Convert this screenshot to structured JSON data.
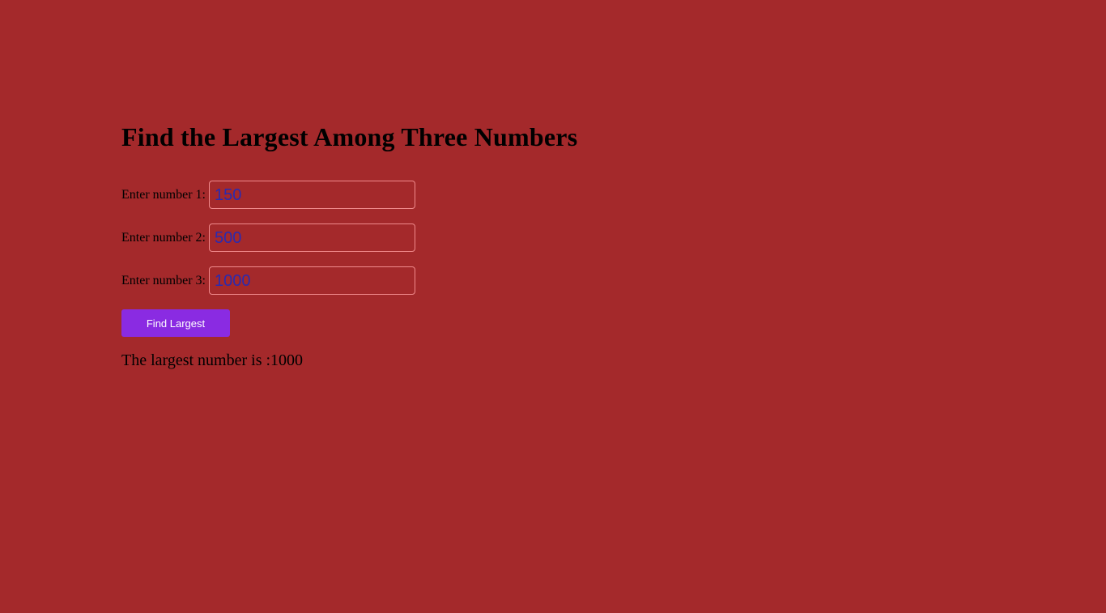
{
  "page": {
    "title": "Find the Largest Among Three Numbers"
  },
  "form": {
    "fields": [
      {
        "label": "Enter number 1:",
        "value": "150"
      },
      {
        "label": "Enter number 2:",
        "value": "500"
      },
      {
        "label": "Enter number 3:",
        "value": "1000"
      }
    ],
    "button_label": "Find Largest"
  },
  "result": {
    "text": "The largest number is :1000"
  },
  "colors": {
    "background": "#a4292b",
    "button": "#8a2be2",
    "input_text": "#2a2ab0",
    "input_border": "#f08a8c"
  }
}
